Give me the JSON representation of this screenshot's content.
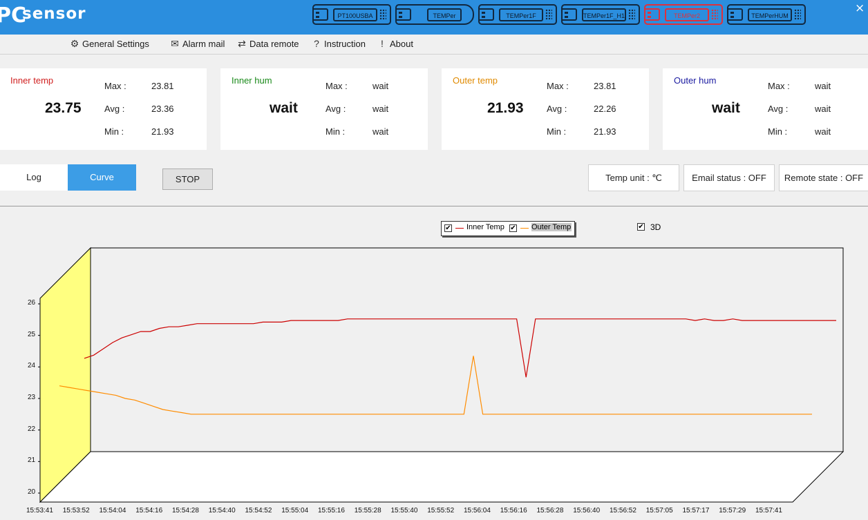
{
  "app": {
    "logo_prefix": "PC",
    "logo_text": "sensor",
    "close_glyph": "×"
  },
  "devices": [
    {
      "label": "PT100USBA",
      "active": false
    },
    {
      "label": "TEMPer",
      "active": false
    },
    {
      "label": "TEMPer1F",
      "active": false
    },
    {
      "label": "TEMPer1F_H1",
      "active": false
    },
    {
      "label": "TEMPer2",
      "active": true
    },
    {
      "label": "TEMPerHUM",
      "active": false
    }
  ],
  "menu": {
    "general_settings": "General Settings",
    "alarm_mail": "Alarm mail",
    "data_remote": "Data remote",
    "instruction": "Instruction",
    "about": "About"
  },
  "cards": [
    {
      "title": "Inner temp",
      "title_color": "#d02020",
      "value": "23.75",
      "max_label": "Max :",
      "max": "23.81",
      "avg_label": "Avg :",
      "avg": "23.36",
      "min_label": "Min :",
      "min": "21.93"
    },
    {
      "title": "Inner hum",
      "title_color": "#1a8a1a",
      "value": "wait",
      "max_label": "Max :",
      "max": "wait",
      "avg_label": "Avg :",
      "avg": "wait",
      "min_label": "Min :",
      "min": "wait"
    },
    {
      "title": "Outer temp",
      "title_color": "#e08a00",
      "value": "21.93",
      "max_label": "Max :",
      "max": "23.81",
      "avg_label": "Avg :",
      "avg": "22.26",
      "min_label": "Min :",
      "min": "21.93"
    },
    {
      "title": "Outer hum",
      "title_color": "#1a1aa0",
      "value": "wait",
      "max_label": "Max :",
      "max": "wait",
      "avg_label": "Avg :",
      "avg": "wait",
      "min_label": "Min :",
      "min": "wait"
    }
  ],
  "controls": {
    "log_tab": "Log",
    "curve_tab": "Curve",
    "stop_button": "STOP",
    "temp_unit": "Temp unit : ℃",
    "email_status": "Email status : OFF",
    "remote_state": "Remote state : OFF"
  },
  "legend": {
    "inner": "Inner Temp",
    "outer": "Outer Temp",
    "three_d": "3D",
    "inner_checked": true,
    "outer_checked": true,
    "three_d_checked": true
  },
  "chart_data": {
    "type": "line",
    "three_d": true,
    "ylim": [
      20,
      26
    ],
    "y_ticks": [
      "20",
      "21",
      "22",
      "23",
      "24",
      "25",
      "26"
    ],
    "x_ticks": [
      "15:53:41",
      "15:53:52",
      "15:54:04",
      "15:54:16",
      "15:54:28",
      "15:54:40",
      "15:54:52",
      "15:55:04",
      "15:55:16",
      "15:55:28",
      "15:55:40",
      "15:55:52",
      "15:56:04",
      "15:56:16",
      "15:56:28",
      "15:56:40",
      "15:56:52",
      "15:57:05",
      "15:57:17",
      "15:57:29",
      "15:57:41"
    ],
    "series": [
      {
        "name": "Inner Temp",
        "color": "#cc0000",
        "values": [
          23.9,
          24.0,
          24.2,
          24.4,
          24.55,
          24.65,
          24.75,
          24.75,
          24.85,
          24.9,
          24.9,
          24.95,
          25.0,
          25.0,
          25.0,
          25.0,
          25.0,
          25.0,
          25.0,
          25.05,
          25.05,
          25.05,
          25.1,
          25.1,
          25.1,
          25.1,
          25.1,
          25.1,
          25.15,
          25.15,
          25.15,
          25.15,
          25.15,
          25.15,
          25.15,
          25.15,
          25.15,
          25.15,
          25.15,
          25.15,
          25.15,
          25.15,
          25.15,
          25.15,
          25.15,
          25.15,
          25.15,
          23.3,
          25.15,
          25.15,
          25.15,
          25.15,
          25.15,
          25.15,
          25.15,
          25.15,
          25.15,
          25.15,
          25.15,
          25.15,
          25.15,
          25.15,
          25.15,
          25.15,
          25.15,
          25.1,
          25.15,
          25.1,
          25.1,
          25.15,
          25.1,
          25.1,
          25.1,
          25.1,
          25.1,
          25.1,
          25.1,
          25.1,
          25.1,
          25.1,
          25.1
        ]
      },
      {
        "name": "Outer Temp",
        "color": "#ff8c00",
        "values": [
          23.4,
          23.35,
          23.3,
          23.25,
          23.2,
          23.15,
          23.1,
          23.0,
          22.95,
          22.85,
          22.75,
          22.65,
          22.6,
          22.55,
          22.5,
          22.5,
          22.5,
          22.5,
          22.5,
          22.5,
          22.5,
          22.5,
          22.5,
          22.5,
          22.5,
          22.5,
          22.5,
          22.5,
          22.5,
          22.5,
          22.5,
          22.5,
          22.5,
          22.5,
          22.5,
          22.5,
          22.5,
          22.5,
          22.5,
          22.5,
          22.5,
          22.5,
          22.5,
          22.5,
          24.35,
          22.5,
          22.5,
          22.5,
          22.5,
          22.5,
          22.5,
          22.5,
          22.5,
          22.5,
          22.5,
          22.5,
          22.5,
          22.5,
          22.5,
          22.5,
          22.5,
          22.5,
          22.5,
          22.5,
          22.5,
          22.5,
          22.5,
          22.5,
          22.5,
          22.5,
          22.5,
          22.5,
          22.5,
          22.5,
          22.5,
          22.5,
          22.5,
          22.5,
          22.5,
          22.5,
          22.5
        ]
      }
    ]
  }
}
